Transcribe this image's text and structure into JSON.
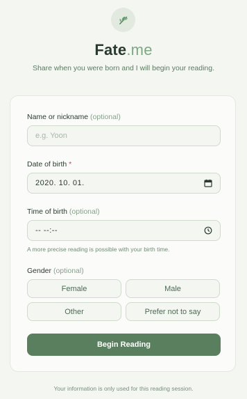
{
  "brand": {
    "name_part1": "Fate",
    "name_part2": ".me",
    "logo_icon": "leaf-icon"
  },
  "tagline": "Share when you were born and I will begin your reading.",
  "form": {
    "name": {
      "label": "Name or nickname",
      "optional_text": "(optional)",
      "placeholder": "e.g. Yoon"
    },
    "dob": {
      "label": "Date of birth",
      "required_mark": "*",
      "value": "2020. 10. 01.",
      "icon": "calendar-icon"
    },
    "tob": {
      "label": "Time of birth",
      "optional_text": "(optional)",
      "value": "-- --:--",
      "icon": "clock-icon",
      "hint": "A more precise reading is possible with your birth time."
    },
    "gender": {
      "label": "Gender",
      "optional_text": "(optional)",
      "options": [
        "Female",
        "Male",
        "Other",
        "Prefer not to say"
      ]
    },
    "submit_label": "Begin Reading"
  },
  "footer": "Your information is only used for this reading session.",
  "colors": {
    "accent": "#5a7f5e",
    "brand_light": "#7ea884",
    "required": "#d14a4a",
    "background": "#f4f6f2"
  }
}
